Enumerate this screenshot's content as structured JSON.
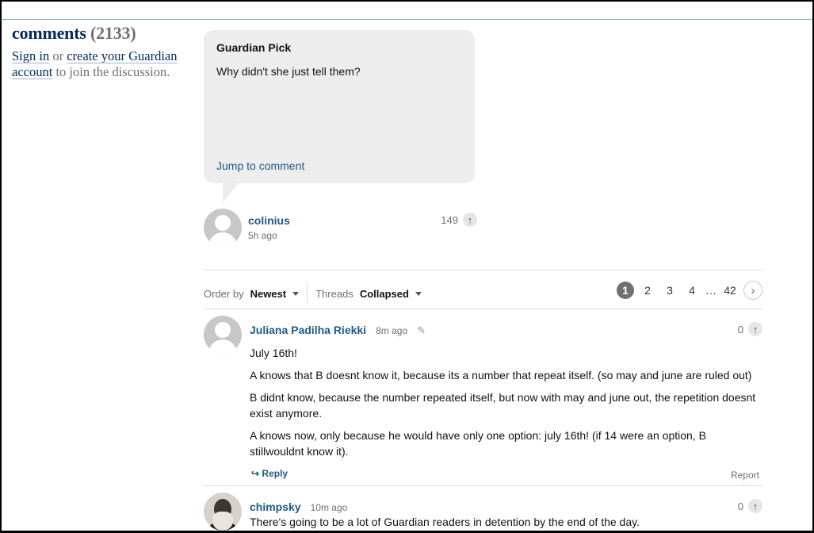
{
  "comments": {
    "heading": "comments",
    "count": "(2133)",
    "sign_in": "Sign in",
    "or": " or ",
    "create_account": "create your Guardian account",
    "join_text": " to join the discussion."
  },
  "pick": {
    "title": "Guardian Pick",
    "body": "Why didn't she just tell them?",
    "jump_label": "Jump to comment",
    "author": "colinius",
    "time": "5h ago",
    "votes": "149"
  },
  "toolbar": {
    "order_label": "Order by",
    "order_value": "Newest",
    "threads_label": "Threads",
    "threads_value": "Collapsed",
    "pages": [
      "1",
      "2",
      "3",
      "4"
    ],
    "ellipsis": "…",
    "last_page": "42",
    "active_page": "1"
  },
  "comment_list": [
    {
      "author": "Juliana Padilha Riekki",
      "time": "8m ago",
      "votes": "0",
      "paragraphs": [
        "July 16th!",
        "A knows that B doesnt know it, because its a number that repeat itself. (so may and june are ruled out)",
        "B didnt know, because the number repeated itself, but now with may and june out, the repetition doesnt exist anymore.",
        "A knows now, only because he would have only one option: july 16th! (if 14 were an option, B stillwouldnt know it)."
      ],
      "reply_label": "Reply",
      "report_label": "Report"
    },
    {
      "author": "chimpsky",
      "time": "10m ago",
      "votes": "0",
      "paragraphs": [
        "There's going to be a lot of Guardian readers in detention by the end of the day."
      ]
    }
  ],
  "icons": {
    "upvote": "arrow-up-icon",
    "reply": "reply-arrow-icon",
    "edit": "paperclip-icon",
    "next": "chevron-right-icon"
  },
  "colors": {
    "brand": "#052962",
    "link": "#1f5a86",
    "muted": "#707070",
    "pick_bg": "#ededed"
  }
}
